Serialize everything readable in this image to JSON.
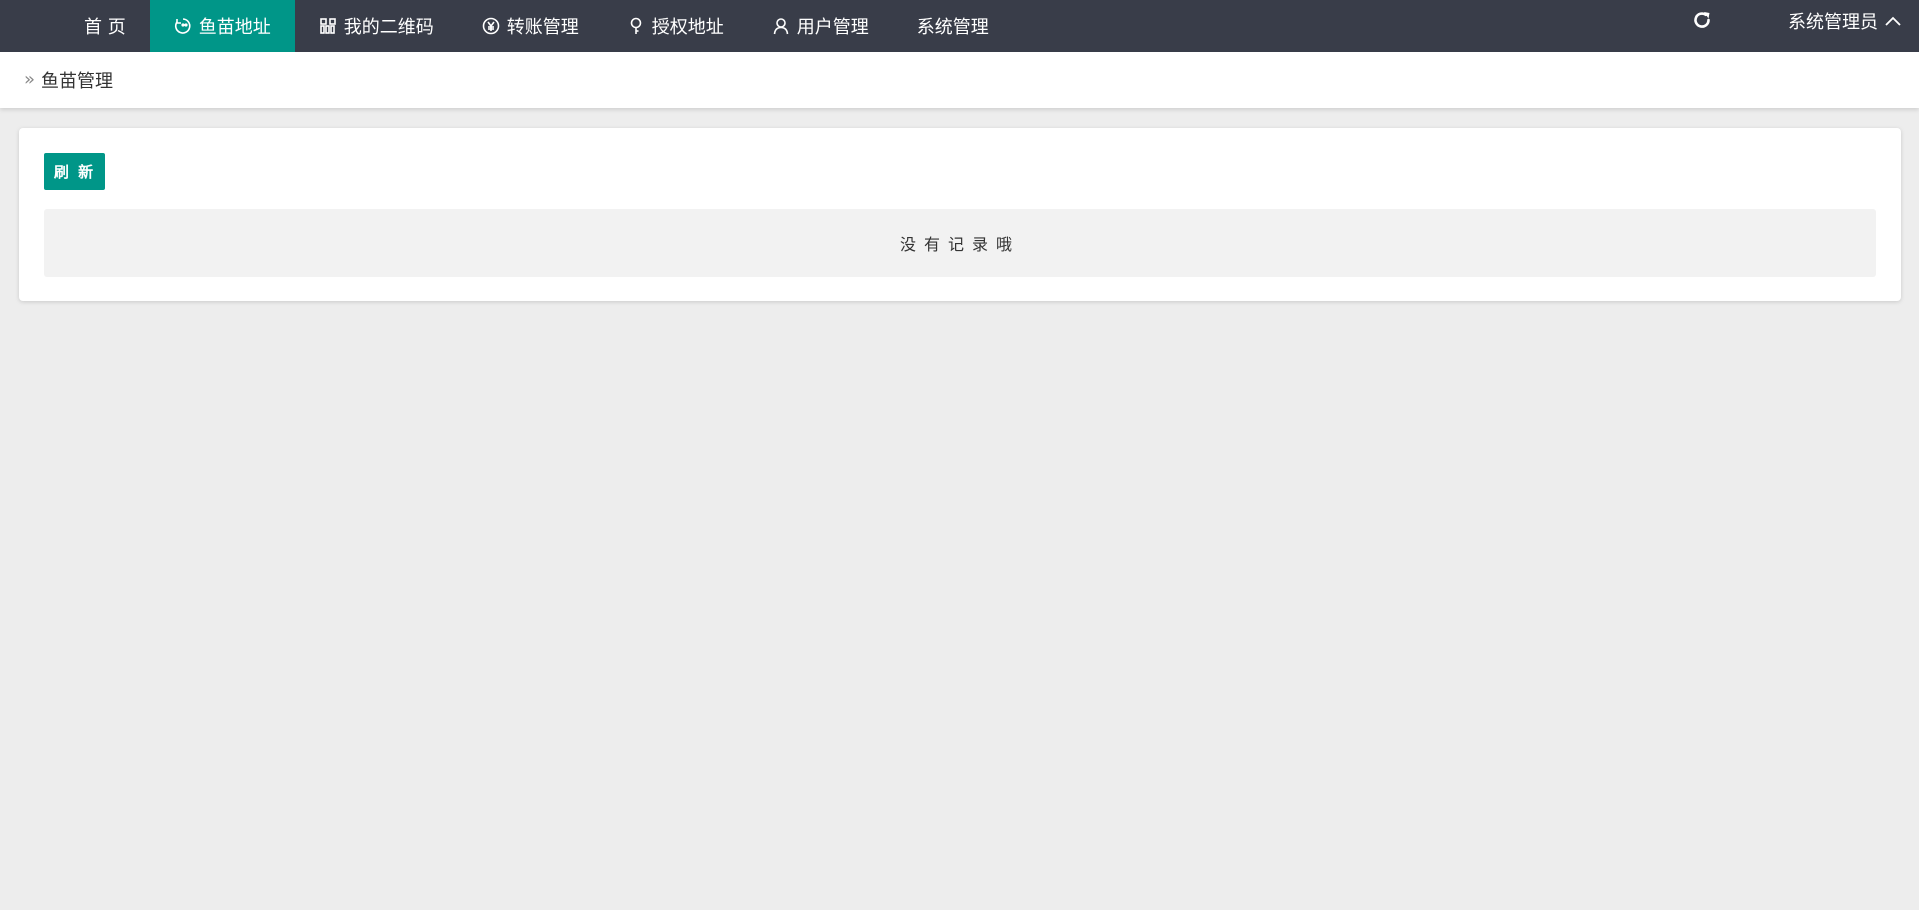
{
  "nav": {
    "items": [
      {
        "label": "首 页",
        "icon": "",
        "active": false
      },
      {
        "label": "鱼苗地址",
        "icon": "fish-icon",
        "active": true
      },
      {
        "label": "我的二维码",
        "icon": "qrcode-icon",
        "active": false
      },
      {
        "label": "转账管理",
        "icon": "yuan-icon",
        "active": false
      },
      {
        "label": "授权地址",
        "icon": "key-icon",
        "active": false
      },
      {
        "label": "用户管理",
        "icon": "user-icon",
        "active": false
      },
      {
        "label": "系统管理",
        "icon": "",
        "active": false
      }
    ]
  },
  "header": {
    "refresh_icon": "refresh-icon",
    "user_label": "系统管理员",
    "user_chevron": "chevron-up-icon"
  },
  "breadcrumb": {
    "icon": "double-chevron-right-icon",
    "label": "鱼苗管理"
  },
  "main": {
    "refresh_button": "刷 新",
    "empty_text": "没有记录哦"
  },
  "colors": {
    "topbar": "#393d49",
    "accent": "#009688",
    "background": "#ededed"
  }
}
